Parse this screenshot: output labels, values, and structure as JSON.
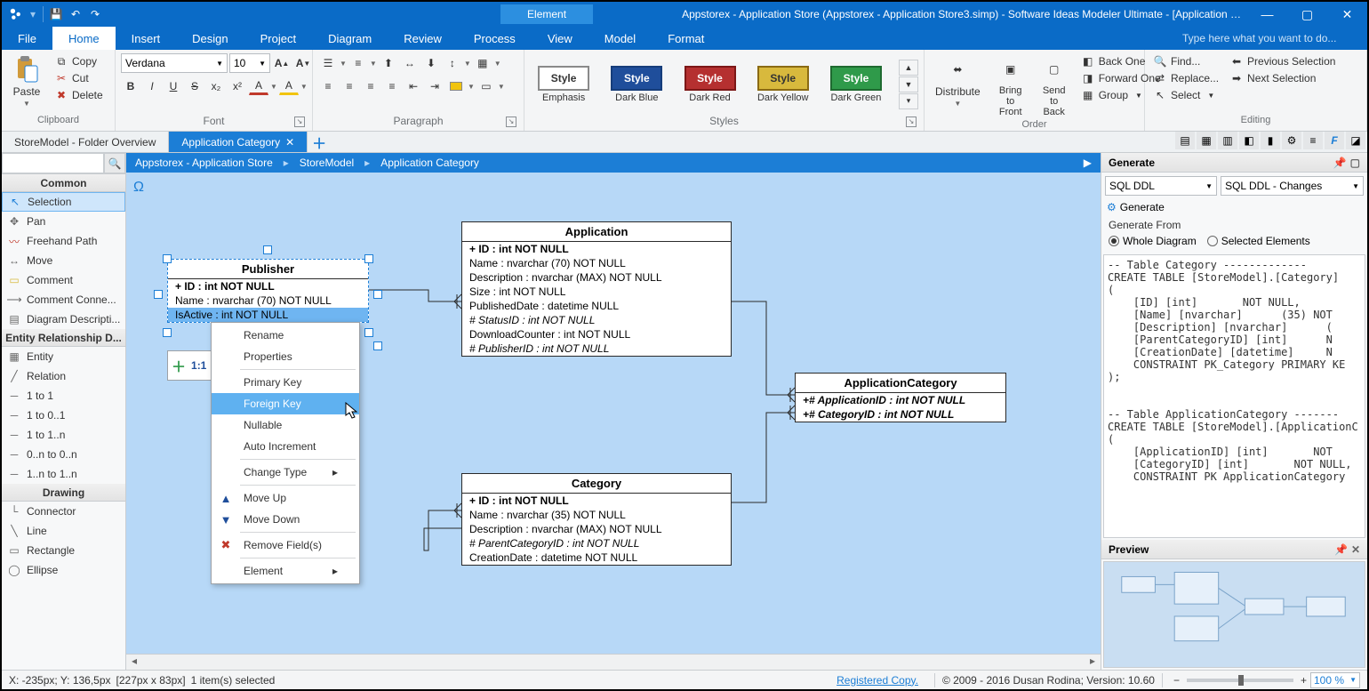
{
  "titlebar": {
    "context_tab": "Element",
    "title": "Appstorex - Application Store (Appstorex - Application Store3.simp)  - Software Ideas Modeler Ultimate - [Application Category]"
  },
  "menu": {
    "file": "File",
    "tabs": [
      "Home",
      "Insert",
      "Design",
      "Project",
      "Diagram",
      "Review",
      "Process",
      "View",
      "Model",
      "Format"
    ],
    "active": 0,
    "search_placeholder": "Type here what you want to do..."
  },
  "ribbon": {
    "clipboard": {
      "paste": "Paste",
      "copy": "Copy",
      "cut": "Cut",
      "delete": "Delete",
      "label": "Clipboard"
    },
    "font": {
      "family": "Verdana",
      "size": "10",
      "label": "Font"
    },
    "paragraph": {
      "label": "Paragraph"
    },
    "styles": {
      "label": "Styles",
      "items": [
        {
          "name": "Emphasis",
          "border": "#8a8a8a",
          "fill": "#ffffff",
          "text": "#333333"
        },
        {
          "name": "Dark Blue",
          "border": "#163d7a",
          "fill": "#1f4e9b",
          "text": "#ffffff"
        },
        {
          "name": "Dark Red",
          "border": "#7c1717",
          "fill": "#b53030",
          "text": "#ffffff"
        },
        {
          "name": "Dark Yellow",
          "border": "#8a6a13",
          "fill": "#d8b93d",
          "text": "#333333"
        },
        {
          "name": "Dark Green",
          "border": "#1e6a30",
          "fill": "#2f9a4a",
          "text": "#ffffff"
        }
      ]
    },
    "order": {
      "distribute": "Distribute",
      "bring_front": "Bring to Front",
      "send_back": "Send to Back",
      "back_one": "Back One",
      "forward_one": "Forward One",
      "group": "Group",
      "label": "Order"
    },
    "editing": {
      "find": "Find...",
      "replace": "Replace...",
      "select": "Select",
      "prev_sel": "Previous Selection",
      "next_sel": "Next Selection",
      "label": "Editing"
    }
  },
  "doctabs": {
    "items": [
      "StoreModel - Folder Overview",
      "Application Category"
    ],
    "active": 1
  },
  "breadcrumb": [
    "Appstorex - Application Store",
    "StoreModel",
    "Application Category"
  ],
  "toolbox": {
    "common_label": "Common",
    "common": [
      "Selection",
      "Pan",
      "Freehand Path",
      "Move",
      "Comment",
      "Comment Conne...",
      "Diagram Descripti..."
    ],
    "erd_label": "Entity Relationship D...",
    "erd": [
      "Entity",
      "Relation",
      "1 to 1",
      "1 to 0..1",
      "1 to 1..n",
      "0..n to 0..n",
      "1..n to 1..n"
    ],
    "drawing_label": "Drawing",
    "drawing": [
      "Connector",
      "Line",
      "Rectangle",
      "Ellipse"
    ]
  },
  "entities": {
    "publisher": {
      "name": "Publisher",
      "fields": [
        "+ ID : int NOT NULL",
        "Name : nvarchar (70)  NOT NULL",
        "IsActive : int NOT NULL"
      ]
    },
    "application": {
      "name": "Application",
      "fields": [
        "+ ID : int NOT NULL",
        "Name : nvarchar (70)  NOT NULL",
        "Description : nvarchar (MAX)  NOT NULL",
        "Size : int NOT NULL",
        "PublishedDate : datetime NULL",
        "# StatusID : int NOT NULL",
        "DownloadCounter : int NOT NULL",
        "# PublisherID : int NOT NULL"
      ]
    },
    "appcat": {
      "name": "ApplicationCategory",
      "fields": [
        "+# ApplicationID : int NOT NULL",
        "+# CategoryID : int NOT NULL"
      ]
    },
    "category": {
      "name": "Category",
      "fields": [
        "+ ID : int NOT NULL",
        "Name : nvarchar (35)  NOT NULL",
        "Description : nvarchar (MAX)  NOT NULL",
        "# ParentCategoryID : int NOT NULL",
        "CreationDate : datetime NOT NULL"
      ]
    }
  },
  "palette_label": "1:1",
  "context_menu": {
    "items": [
      {
        "t": "Rename"
      },
      {
        "t": "Properties"
      },
      {
        "sep": true
      },
      {
        "t": "Primary Key"
      },
      {
        "t": "Foreign Key",
        "hover": true
      },
      {
        "t": "Nullable"
      },
      {
        "t": "Auto Increment"
      },
      {
        "sep": true
      },
      {
        "t": "Change Type",
        "sub": true
      },
      {
        "sep": true
      },
      {
        "t": "Move Up",
        "icon": "▲",
        "iconcolor": "#1f4e9b"
      },
      {
        "t": "Move Down",
        "icon": "▼",
        "iconcolor": "#1f4e9b"
      },
      {
        "sep": true
      },
      {
        "t": "Remove Field(s)",
        "icon": "✖",
        "iconcolor": "#c0392b"
      },
      {
        "sep": true
      },
      {
        "t": "Element",
        "sub": true
      }
    ]
  },
  "generate": {
    "header": "Generate",
    "type": "SQL DDL",
    "variant": "SQL DDL - Changes",
    "button": "Generate",
    "from_label": "Generate From",
    "whole": "Whole Diagram",
    "selected": "Selected Elements",
    "code": "-- Table Category -------------\nCREATE TABLE [StoreModel].[Category]\n(\n    [ID] [int]       NOT NULL,\n    [Name] [nvarchar]      (35) NOT\n    [Description] [nvarchar]      (\n    [ParentCategoryID] [int]      N\n    [CreationDate] [datetime]     N\n    CONSTRAINT PK_Category PRIMARY KE\n);\n\n\n-- Table ApplicationCategory -------\nCREATE TABLE [StoreModel].[ApplicationC\n(\n    [ApplicationID] [int]       NOT\n    [CategoryID] [int]       NOT NULL,\n    CONSTRAINT PK ApplicationCategory"
  },
  "preview": {
    "header": "Preview"
  },
  "status": {
    "coords": "X: -235px; Y: 136,5px",
    "size": "[227px x 83px]",
    "sel": "1 item(s) selected",
    "reg": "Registered Copy.",
    "copy": "© 2009 - 2016 Dusan Rodina; Version: 10.60",
    "zoom": "100 %"
  }
}
